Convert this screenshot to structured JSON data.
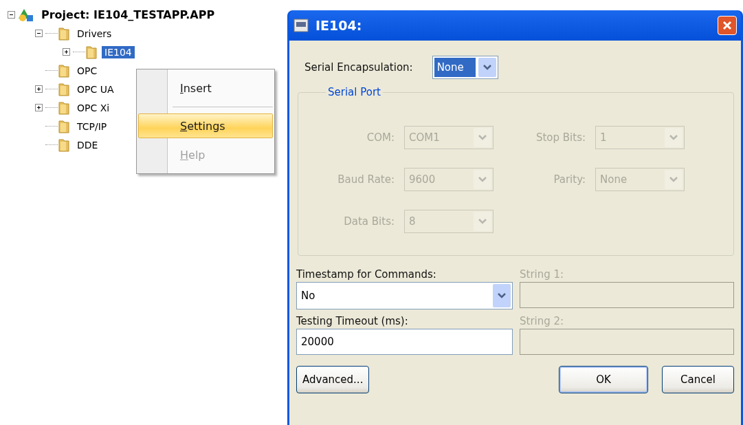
{
  "tree": {
    "label": "Project: IE104_TESTAPP.APP",
    "expanded": true,
    "children": [
      {
        "label": "Drivers",
        "expanded": true,
        "selected": false,
        "children": [
          {
            "label": "IE104",
            "expanded": false,
            "selected": true
          }
        ]
      },
      {
        "label": "OPC",
        "selected": false
      },
      {
        "label": "OPC UA",
        "expanded": false,
        "selected": false
      },
      {
        "label": "OPC Xi",
        "expanded": false,
        "selected": false
      },
      {
        "label": "TCP/IP",
        "selected": false
      },
      {
        "label": "DDE",
        "selected": false
      }
    ]
  },
  "context_menu": {
    "items": [
      {
        "kind": "item",
        "label": "Insert",
        "selected": false,
        "disabled": false
      },
      {
        "kind": "separator"
      },
      {
        "kind": "item",
        "label": "Settings",
        "selected": true,
        "disabled": false
      },
      {
        "kind": "item",
        "label": "Help",
        "selected": false,
        "disabled": true
      }
    ]
  },
  "dialog": {
    "title": "IE104:",
    "serial_encapsulation": {
      "label": "Serial Encapsulation:",
      "value": "None"
    },
    "serial_port": {
      "title": "Serial Port",
      "disabled": true,
      "fields": [
        {
          "label": "COM:",
          "value": "COM1"
        },
        {
          "label": "Stop Bits:",
          "value": "1"
        },
        {
          "label": "Baud Rate:",
          "value": "9600"
        },
        {
          "label": "Parity:",
          "value": "None"
        },
        {
          "label": "Data Bits:",
          "value": "8"
        }
      ]
    },
    "timestamp": {
      "label": "Timestamp for Commands:",
      "value": "No"
    },
    "string_1": {
      "label": "String 1:",
      "disabled": true
    },
    "testing_timeout": {
      "label": "Testing Timeout (ms):",
      "value": "20000"
    },
    "string_2": {
      "label": "String 2:",
      "disabled": true
    },
    "buttons": [
      {
        "label": "Advanced...",
        "default": false
      },
      {
        "label": "OK",
        "default": true
      },
      {
        "label": "Cancel",
        "default": false
      }
    ]
  }
}
